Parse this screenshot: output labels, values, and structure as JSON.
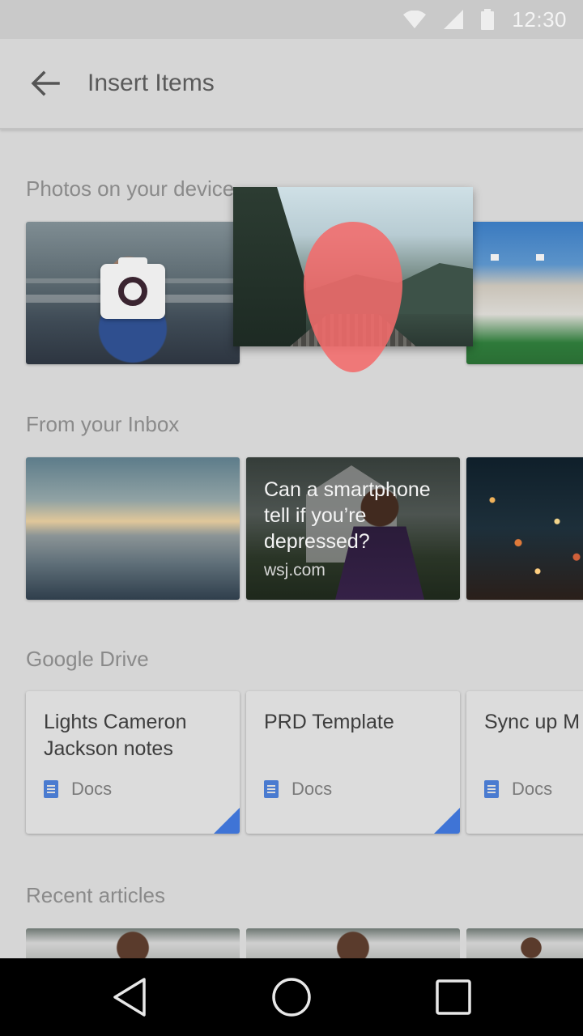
{
  "status_bar": {
    "time": "12:30",
    "icons": [
      "wifi-icon",
      "cell-signal-icon",
      "battery-icon"
    ]
  },
  "app_bar": {
    "title": "Insert Items",
    "back_icon": "arrow-back-icon"
  },
  "sections": {
    "photos": {
      "title": "Photos on your device",
      "items": [
        "camera-photo",
        "mountain-photo",
        "stadium-photo"
      ]
    },
    "inbox": {
      "title": "From your Inbox",
      "items": [
        {
          "kind": "image",
          "subject": "clouds-sunset"
        },
        {
          "kind": "article",
          "headline": "Can a smartphone tell if you’re depressed?",
          "source": "wsj.com"
        },
        {
          "kind": "image",
          "subject": "city-night-lights"
        }
      ]
    },
    "drive": {
      "title": "Google Drive",
      "items": [
        {
          "title": "Lights Cameron Jackson notes",
          "type": "Docs"
        },
        {
          "title": "PRD Template",
          "type": "Docs"
        },
        {
          "title": "Sync up M Notes",
          "type": "Docs"
        }
      ]
    },
    "articles": {
      "title": "Recent articles"
    }
  },
  "nav_bar": {
    "buttons": [
      "back-triangle-icon",
      "home-circle-icon",
      "recents-square-icon"
    ]
  },
  "colors": {
    "background": "#d6d6d6",
    "pin": "#f26b6b",
    "docs_accent": "#3f74d6"
  }
}
